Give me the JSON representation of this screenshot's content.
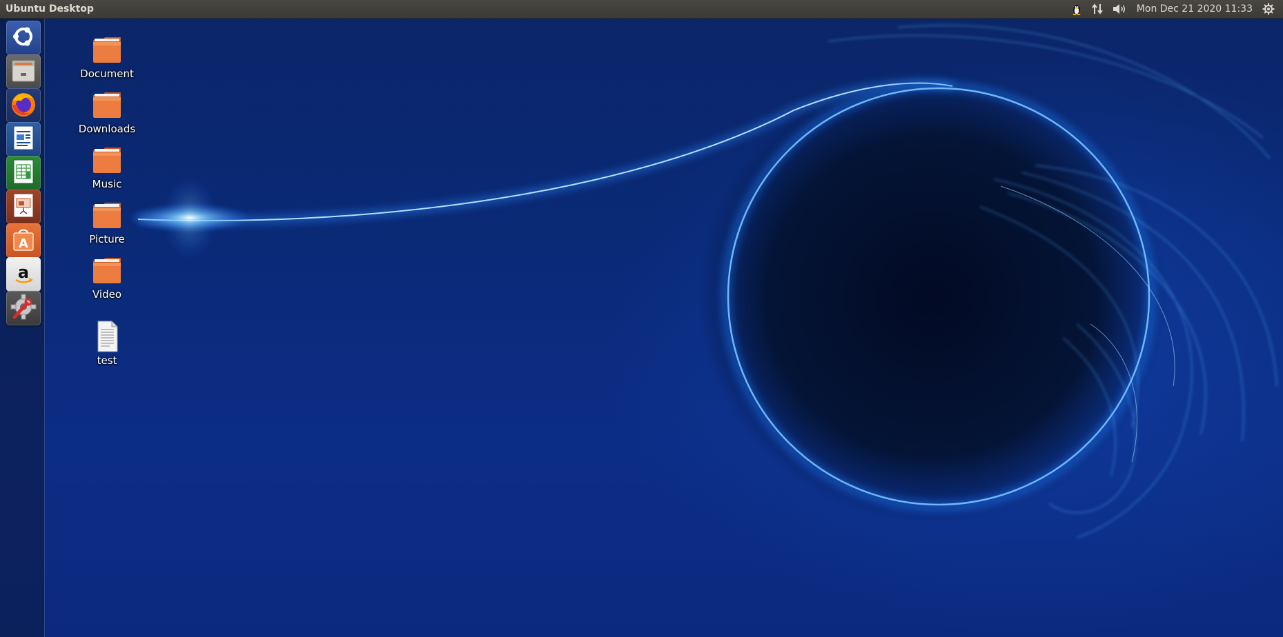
{
  "panel": {
    "title": "Ubuntu Desktop",
    "clock": "Mon Dec 21 2020 11:33",
    "indicators": [
      "tux-icon",
      "network-arrows-icon",
      "volume-icon",
      "gear-icon"
    ]
  },
  "launcher": {
    "items": [
      {
        "name": "ubuntu-dash",
        "icon": "ubuntu-logo-icon"
      },
      {
        "name": "files",
        "icon": "file-cabinet-icon"
      },
      {
        "name": "firefox",
        "icon": "firefox-icon"
      },
      {
        "name": "libreoffice-writer",
        "icon": "writer-document-icon"
      },
      {
        "name": "libreoffice-calc",
        "icon": "calc-spreadsheet-icon"
      },
      {
        "name": "libreoffice-impress",
        "icon": "impress-presentation-icon"
      },
      {
        "name": "ubuntu-software",
        "icon": "software-bag-icon"
      },
      {
        "name": "amazon",
        "icon": "amazon-icon"
      },
      {
        "name": "system-settings",
        "icon": "settings-wrench-gear-icon"
      }
    ]
  },
  "desktop": {
    "icons": [
      {
        "label": "Document",
        "type": "folder"
      },
      {
        "label": "Downloads",
        "type": "folder"
      },
      {
        "label": "Music",
        "type": "folder"
      },
      {
        "label": "Picture",
        "type": "folder"
      },
      {
        "label": "Video",
        "type": "folder"
      },
      {
        "label": "test",
        "type": "text-file"
      }
    ]
  },
  "colors": {
    "panel_bg": "#3c3b37",
    "folder_orange": "#e8743b",
    "wallpaper_blue": "#0a2a78",
    "glow_blue": "#3aa0ff"
  }
}
